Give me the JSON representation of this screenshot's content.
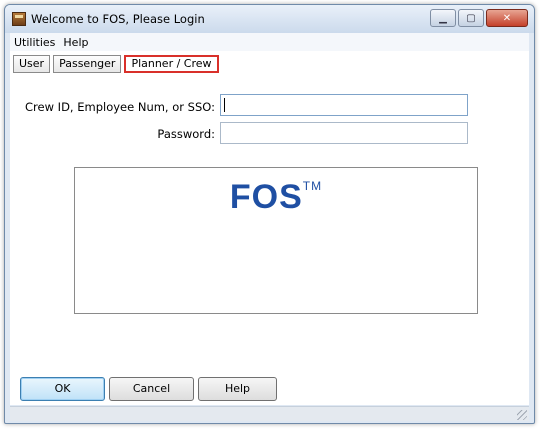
{
  "window": {
    "title": "Welcome to FOS, Please Login"
  },
  "window_buttons": {
    "minimize_icon": "minimize-icon",
    "maximize_icon": "maximize-icon",
    "close_icon": "close-icon"
  },
  "menu": {
    "items": [
      "Utilities",
      "Help"
    ]
  },
  "tabs": {
    "items": [
      "User",
      "Passenger",
      "Planner / Crew"
    ],
    "selected": "Planner / Crew"
  },
  "form": {
    "crew_id_label": "Crew ID, Employee Num, or SSO:",
    "crew_id_value": "",
    "password_label": "Password:",
    "password_value": ""
  },
  "logo": {
    "text": "FOS",
    "trademark": "TM",
    "color": "#1f4fa3"
  },
  "buttons": {
    "ok": "OK",
    "cancel": "Cancel",
    "help": "Help"
  },
  "colors": {
    "selected_tab_border": "#d9302a",
    "default_button": "#3c7fb1"
  }
}
